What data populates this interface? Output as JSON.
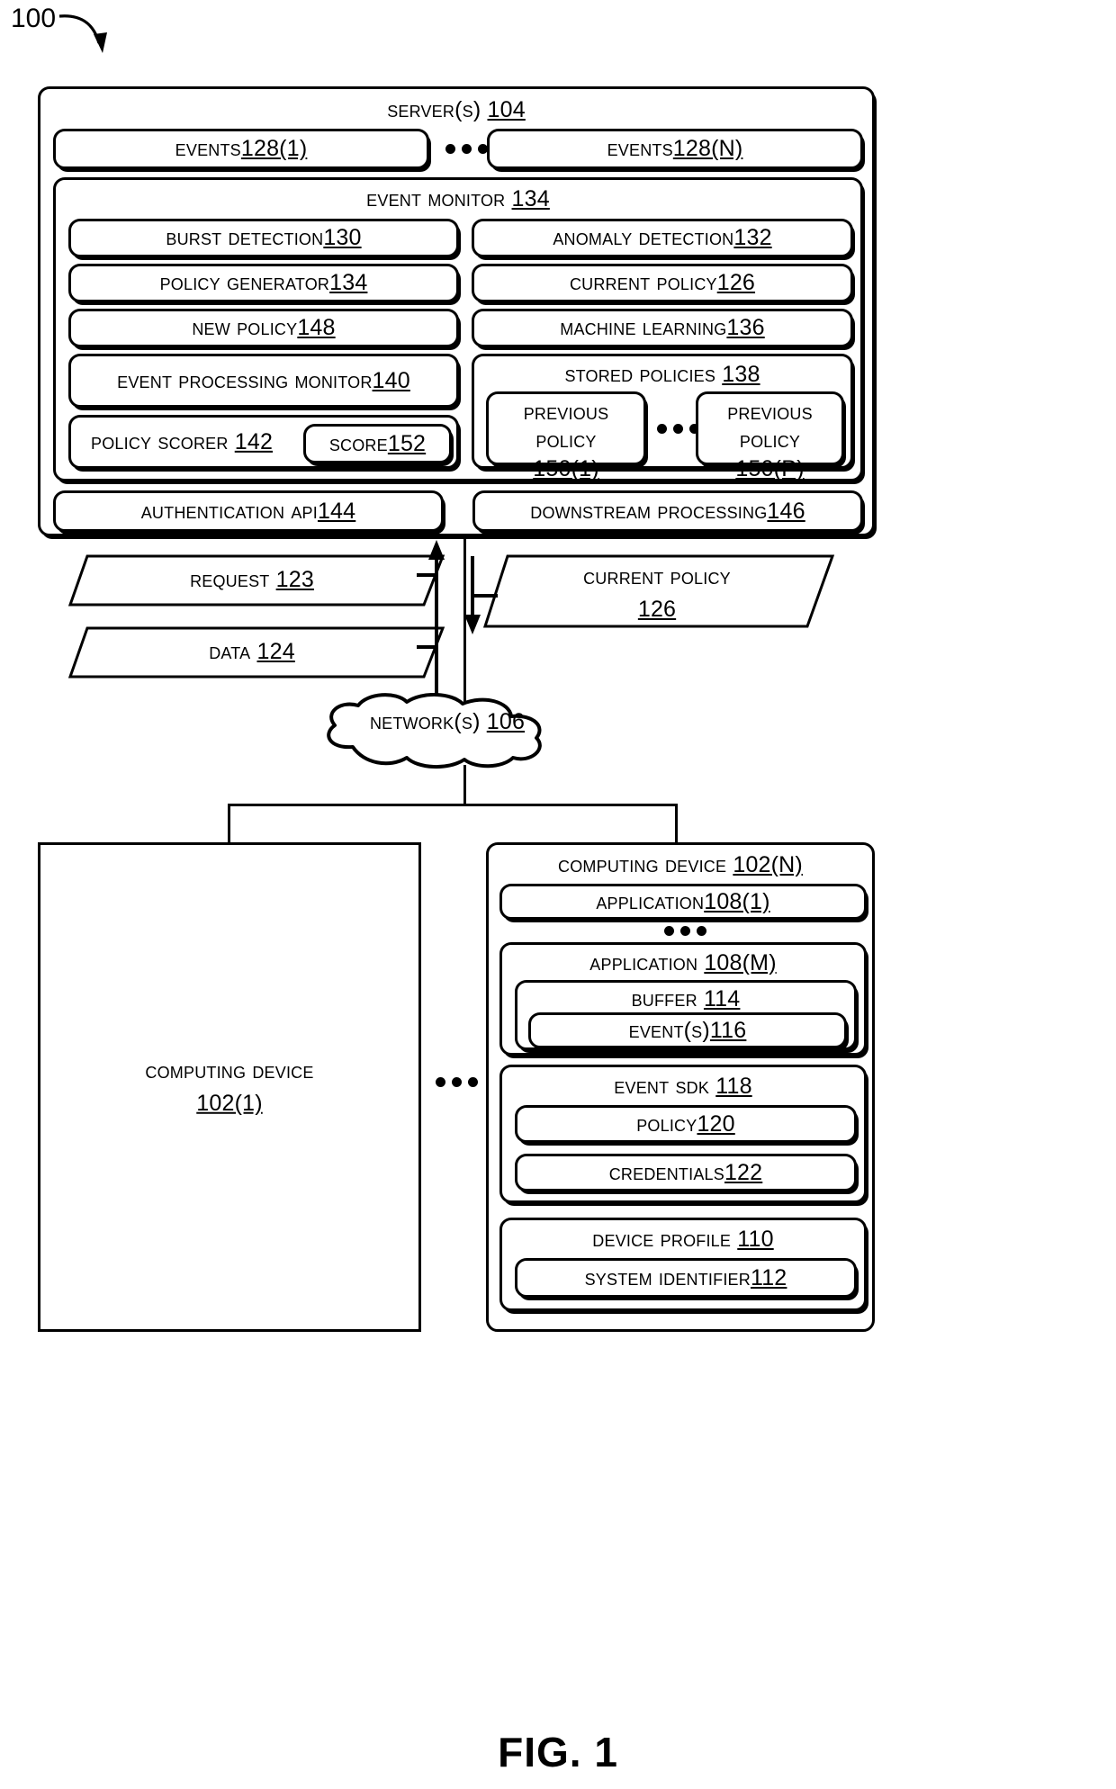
{
  "figure": {
    "ref_number": "100",
    "caption": "FIG. 1"
  },
  "server": {
    "title_text": "Server(s) ",
    "title_num": "104",
    "events": [
      {
        "text": "Events ",
        "num": "128(1)"
      },
      {
        "text": "Events ",
        "num": "128(N)"
      }
    ],
    "events_ellipsis": "•••",
    "event_monitor": {
      "title_text": "Event Monitor ",
      "title_num": "134",
      "left_column": [
        {
          "text": "Burst Detection ",
          "num": "130"
        },
        {
          "text": "Policy Generator ",
          "num": "134"
        },
        {
          "text": "New Policy ",
          "num": "148"
        },
        {
          "text": "Event Processing Monitor ",
          "num": "140"
        }
      ],
      "policy_scorer": {
        "text": "Policy Scorer ",
        "num": "142"
      },
      "score": {
        "text": "Score ",
        "num": "152"
      },
      "right_column": [
        {
          "text": "Anomaly Detection ",
          "num": "132"
        },
        {
          "text": "Current Policy ",
          "num": "126"
        },
        {
          "text": "Machine Learning ",
          "num": "136"
        }
      ],
      "stored_policies": {
        "title_text": "Stored Policies ",
        "title_num": "138",
        "items": [
          {
            "line1": "Previous",
            "line2": "Policy",
            "num": "150(1)"
          },
          {
            "line1": "Previous",
            "line2": "Policy",
            "num": "150(P)"
          }
        ],
        "ellipsis": "•••"
      }
    },
    "bottom_row": [
      {
        "text": "Authentication API ",
        "num": "144"
      },
      {
        "text": "Downstream Processing ",
        "num": "146"
      }
    ]
  },
  "flows": {
    "request": {
      "text": "Request ",
      "num": "123"
    },
    "data": {
      "text": "Data ",
      "num": "124"
    },
    "current_policy": {
      "text": "Current Policy",
      "num": "126"
    }
  },
  "network": {
    "text": "Network(s) ",
    "num": "106"
  },
  "devices": {
    "device_one": {
      "text": "Computing Device",
      "num": "102(1)"
    },
    "devices_ellipsis": "•••",
    "device_n": {
      "title_text": "Computing Device ",
      "title_num": "102(N)",
      "application_1": {
        "text": "Application ",
        "num": "108(1)"
      },
      "app_ellipsis": "•••",
      "application_m": {
        "title_text": "Application ",
        "title_num": "108(M)",
        "buffer": {
          "text": "Buffer ",
          "num": "114"
        },
        "events": {
          "text": "Event(s) ",
          "num": "116"
        }
      },
      "event_sdk": {
        "title_text": "Event SDK ",
        "title_num": "118",
        "policy": {
          "text": "Policy ",
          "num": "120"
        },
        "credentials": {
          "text": "Credentials ",
          "num": "122"
        }
      },
      "device_profile": {
        "title_text": "Device Profile ",
        "title_num": "110",
        "system_identifier": {
          "text": "System Identifier ",
          "num": "112"
        }
      }
    }
  }
}
